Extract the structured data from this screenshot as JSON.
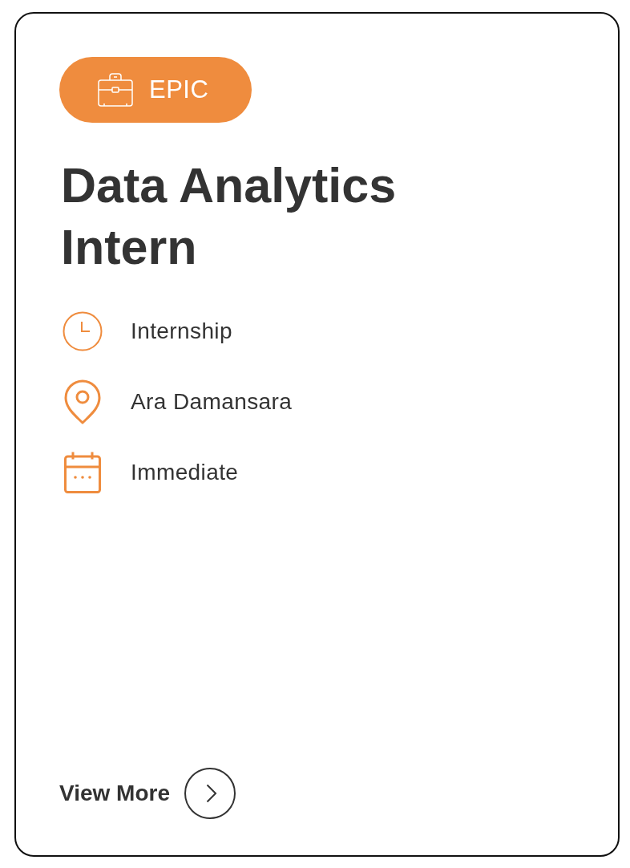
{
  "card": {
    "badge": {
      "label": "EPIC"
    },
    "title": "Data Analytics Intern",
    "details": [
      {
        "kind": "time",
        "text": "Internship"
      },
      {
        "kind": "location",
        "text": "Ara Damansara"
      },
      {
        "kind": "date",
        "text": "Immediate"
      }
    ],
    "action": {
      "label": "View More"
    }
  }
}
